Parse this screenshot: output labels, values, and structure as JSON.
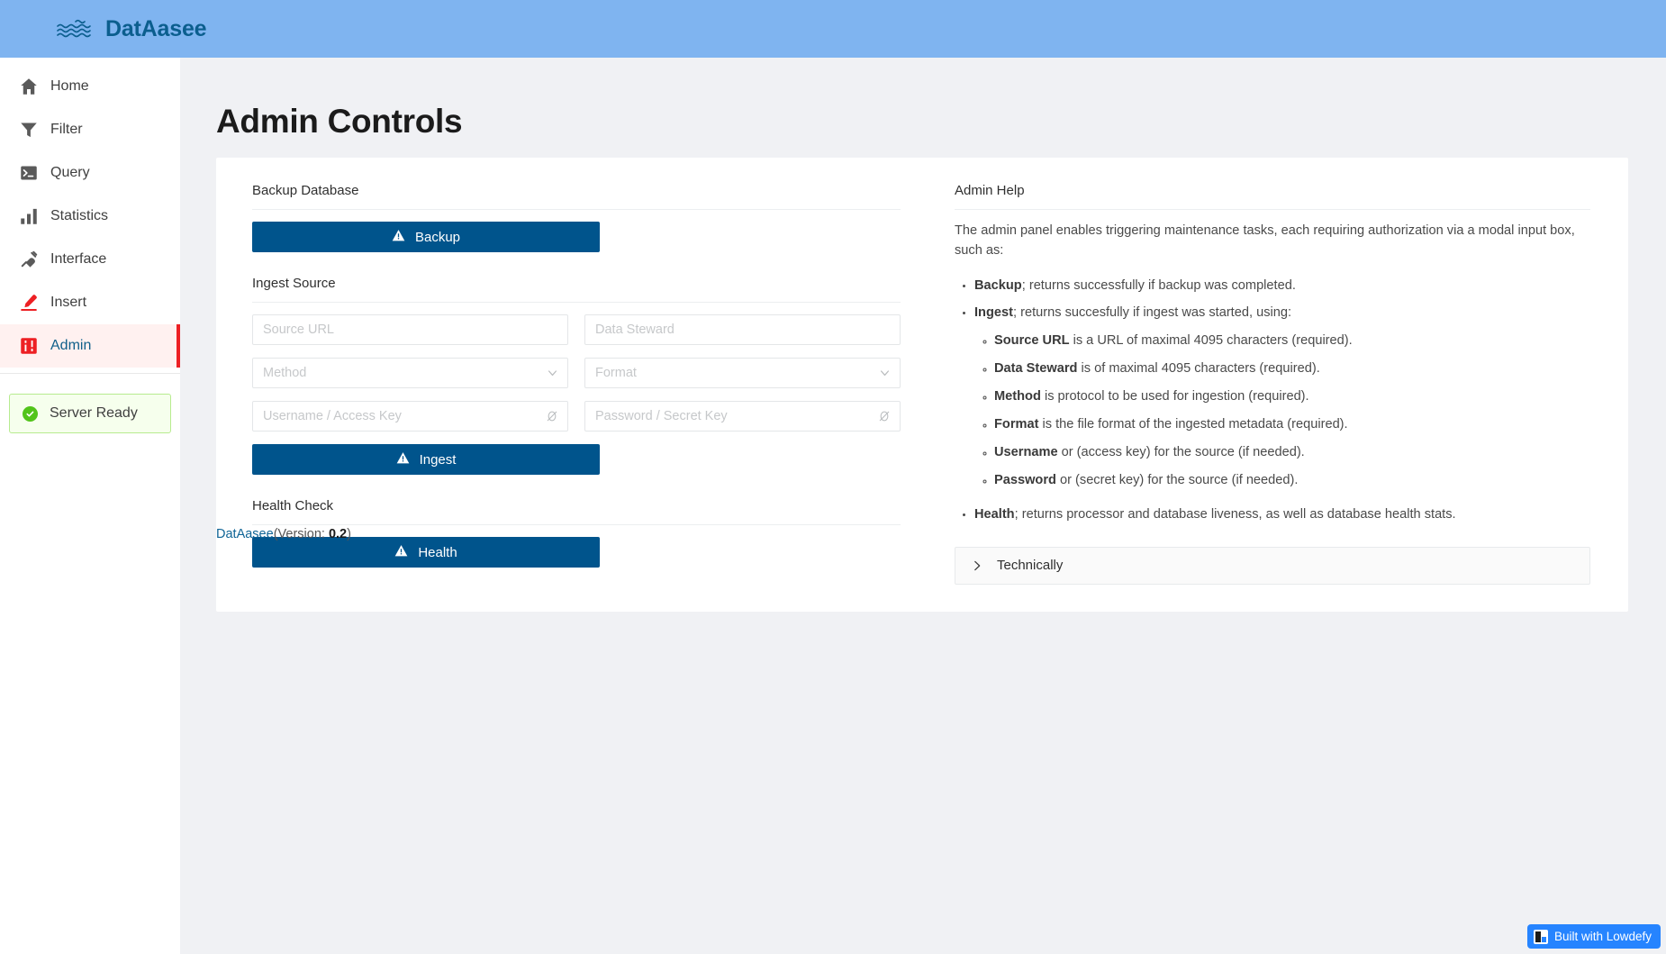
{
  "brand": {
    "name": "DatAasee",
    "logo_icon": "waves-icon"
  },
  "sidebar": {
    "items": [
      {
        "label": "Home",
        "icon": "home-icon",
        "active": false,
        "accent": false
      },
      {
        "label": "Filter",
        "icon": "filter-icon",
        "active": false,
        "accent": false
      },
      {
        "label": "Query",
        "icon": "terminal-icon",
        "active": false,
        "accent": false
      },
      {
        "label": "Statistics",
        "icon": "bar-chart-icon",
        "active": false,
        "accent": false
      },
      {
        "label": "Interface",
        "icon": "plug-icon",
        "active": false,
        "accent": false
      },
      {
        "label": "Insert",
        "icon": "pen-icon",
        "active": false,
        "accent": true
      },
      {
        "label": "Admin",
        "icon": "sliders-icon",
        "active": true,
        "accent": true
      }
    ],
    "status": {
      "label": "Server Ready",
      "icon": "check-circle-icon",
      "color": "#52c41a",
      "background": "#f6ffed",
      "border": "#b7eb8f"
    }
  },
  "page": {
    "title": "Admin Controls"
  },
  "controls": {
    "backup_section_label": "Backup Database",
    "backup_button_label": "Backup",
    "ingest_section_label": "Ingest Source",
    "ingest_button_label": "Ingest",
    "health_section_label": "Health Check",
    "health_button_label": "Health",
    "button_color": "#00548C",
    "fields": {
      "source_url_placeholder": "Source URL",
      "source_url_value": "",
      "data_steward_placeholder": "Data Steward",
      "data_steward_value": "",
      "method_placeholder": "Method",
      "method_value": "",
      "format_placeholder": "Format",
      "format_value": "",
      "username_placeholder": "Username / Access Key",
      "username_value": "",
      "password_placeholder": "Password / Secret Key",
      "password_value": ""
    }
  },
  "help": {
    "title": "Admin Help",
    "intro": "The admin panel enables triggering maintenance tasks, each requiring authorization via a modal input box, such as:",
    "items": [
      {
        "term": "Backup",
        "text": "; returns successfully if backup was completed."
      },
      {
        "term": "Ingest",
        "text": "; returns succesfully if ingest was started, using:"
      },
      {
        "term": "Health",
        "text": "; returns processor and database liveness, as well as database health stats."
      }
    ],
    "subitems": [
      {
        "term": "Source URL",
        "text": " is a URL of maximal 4095 characters (required)."
      },
      {
        "term": "Data Steward",
        "text": " is of maximal 4095 characters (required)."
      },
      {
        "term": "Method",
        "text": " is protocol to be used for ingestion (required)."
      },
      {
        "term": "Format",
        "text": " is the file format of the ingested metadata (required)."
      },
      {
        "term": "Username",
        "text": " or (access key) for the source (if needed)."
      },
      {
        "term": "Password",
        "text": " or (secret key) for the source (if needed)."
      }
    ],
    "accordion_label": "Technically"
  },
  "footer": {
    "link_label": "DatAasee",
    "version_prefix": "(Version: ",
    "version": "0.2",
    "version_suffix": ")"
  },
  "badge": {
    "label": "Built with Lowdefy",
    "color": "#2684FF"
  }
}
